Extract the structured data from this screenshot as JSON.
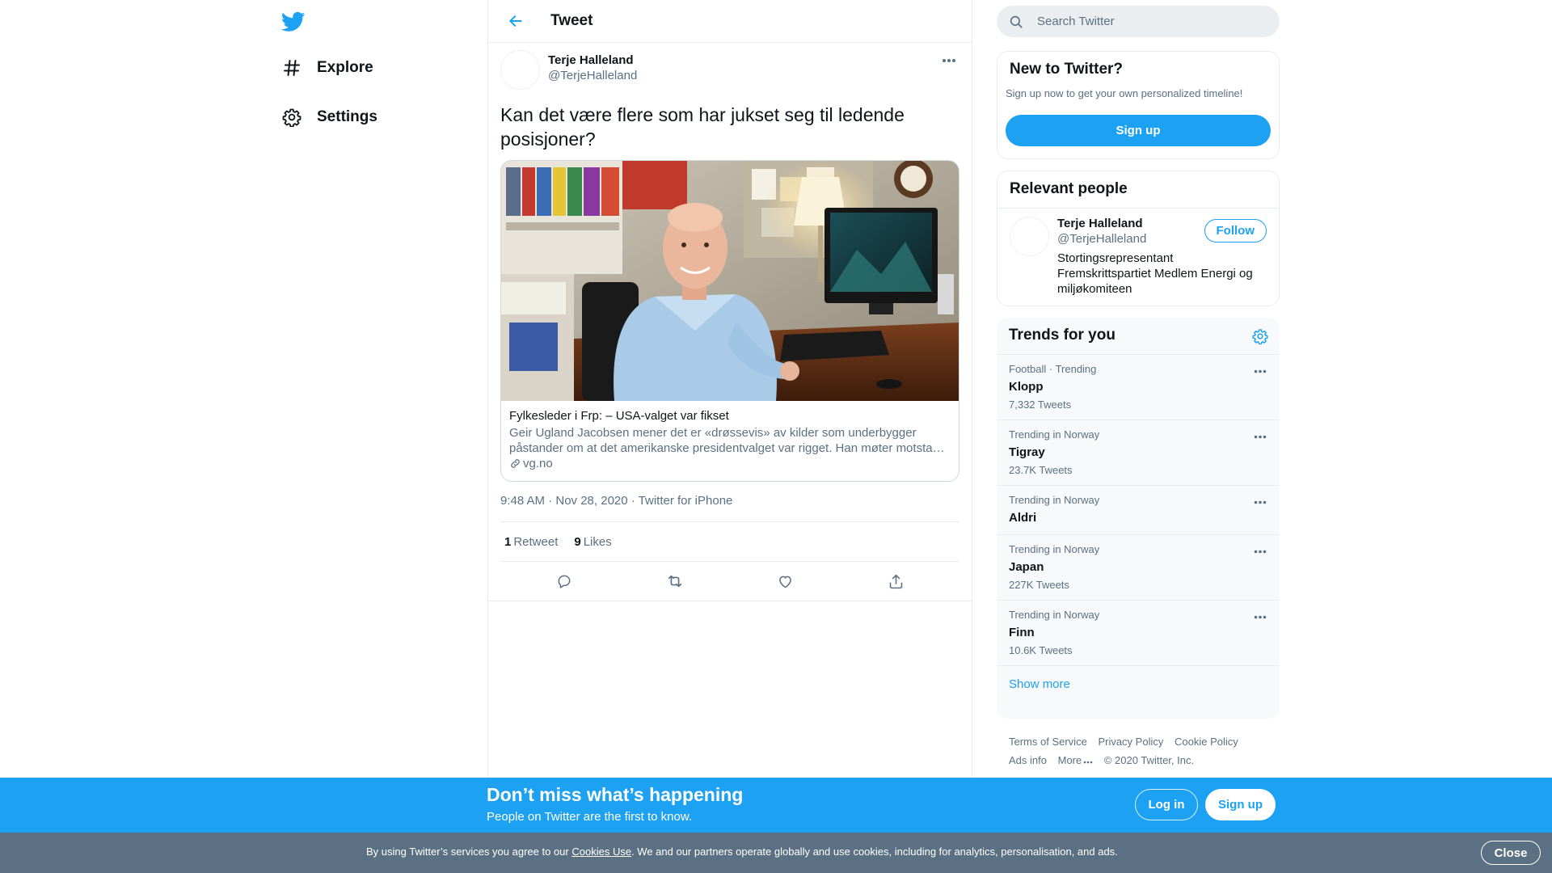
{
  "nav": {
    "items": [
      {
        "label": "Explore",
        "icon": "hashtag-icon"
      },
      {
        "label": "Settings",
        "icon": "gear-icon"
      }
    ]
  },
  "header": {
    "title": "Tweet"
  },
  "tweet": {
    "author_name": "Terje Halleland",
    "author_handle": "@TerjeHalleland",
    "text": "Kan det være flere som har jukset seg til ledende posisjoner?",
    "card": {
      "title": "Fylkesleder i Frp: – USA-valget var fikset",
      "description": "Geir Ugland Jacobsen mener det er «drøssevis» av kilder som underbygger påstander om at det amerikanske presidentvalget var rigget. Han møter motsta…",
      "domain": "vg.no"
    },
    "time": "9:48 AM · Nov 28, 2020",
    "separator": " · ",
    "source": "Twitter for iPhone",
    "retweets_count": "1",
    "retweets_label": "Retweet",
    "likes_count": "9",
    "likes_label": "Likes"
  },
  "search": {
    "placeholder": "Search Twitter"
  },
  "new_to_twitter": {
    "title": "New to Twitter?",
    "subtitle": "Sign up now to get your own personalized timeline!",
    "button": "Sign up"
  },
  "relevant": {
    "title": "Relevant people",
    "name": "Terje Halleland",
    "handle": "@TerjeHalleland",
    "follow": "Follow",
    "bio": "Stortingsrepresentant Fremskrittspartiet Medlem Energi og miljøkomiteen"
  },
  "trends": {
    "title": "Trends for you",
    "items": [
      {
        "context": "Football · Trending",
        "name": "Klopp",
        "count": "7,332 Tweets"
      },
      {
        "context": "Trending in Norway",
        "name": "Tigray",
        "count": "23.7K Tweets"
      },
      {
        "context": "Trending in Norway",
        "name": "Aldri",
        "count": ""
      },
      {
        "context": "Trending in Norway",
        "name": "Japan",
        "count": "227K Tweets"
      },
      {
        "context": "Trending in Norway",
        "name": "Finn",
        "count": "10.6K Tweets"
      }
    ],
    "show_more": "Show more"
  },
  "footer": {
    "terms": "Terms of Service",
    "privacy": "Privacy Policy",
    "cookie": "Cookie Policy",
    "ads": "Ads info",
    "more": "More",
    "copyright": "© 2020 Twitter, Inc."
  },
  "banner": {
    "title": "Don’t miss what’s happening",
    "subtitle": "People on Twitter are the first to know.",
    "login": "Log in",
    "signup": "Sign up"
  },
  "cookies": {
    "text_before": "By using Twitter’s services you agree to our ",
    "link": "Cookies Use",
    "text_after": ". We and our partners operate globally and use cookies, including for analytics, personalisation, and ads.",
    "close": "Close"
  },
  "colors": {
    "accent": "#1da1f2",
    "secondary_text": "#5b7083",
    "cookie_bar": "#5b7083"
  }
}
